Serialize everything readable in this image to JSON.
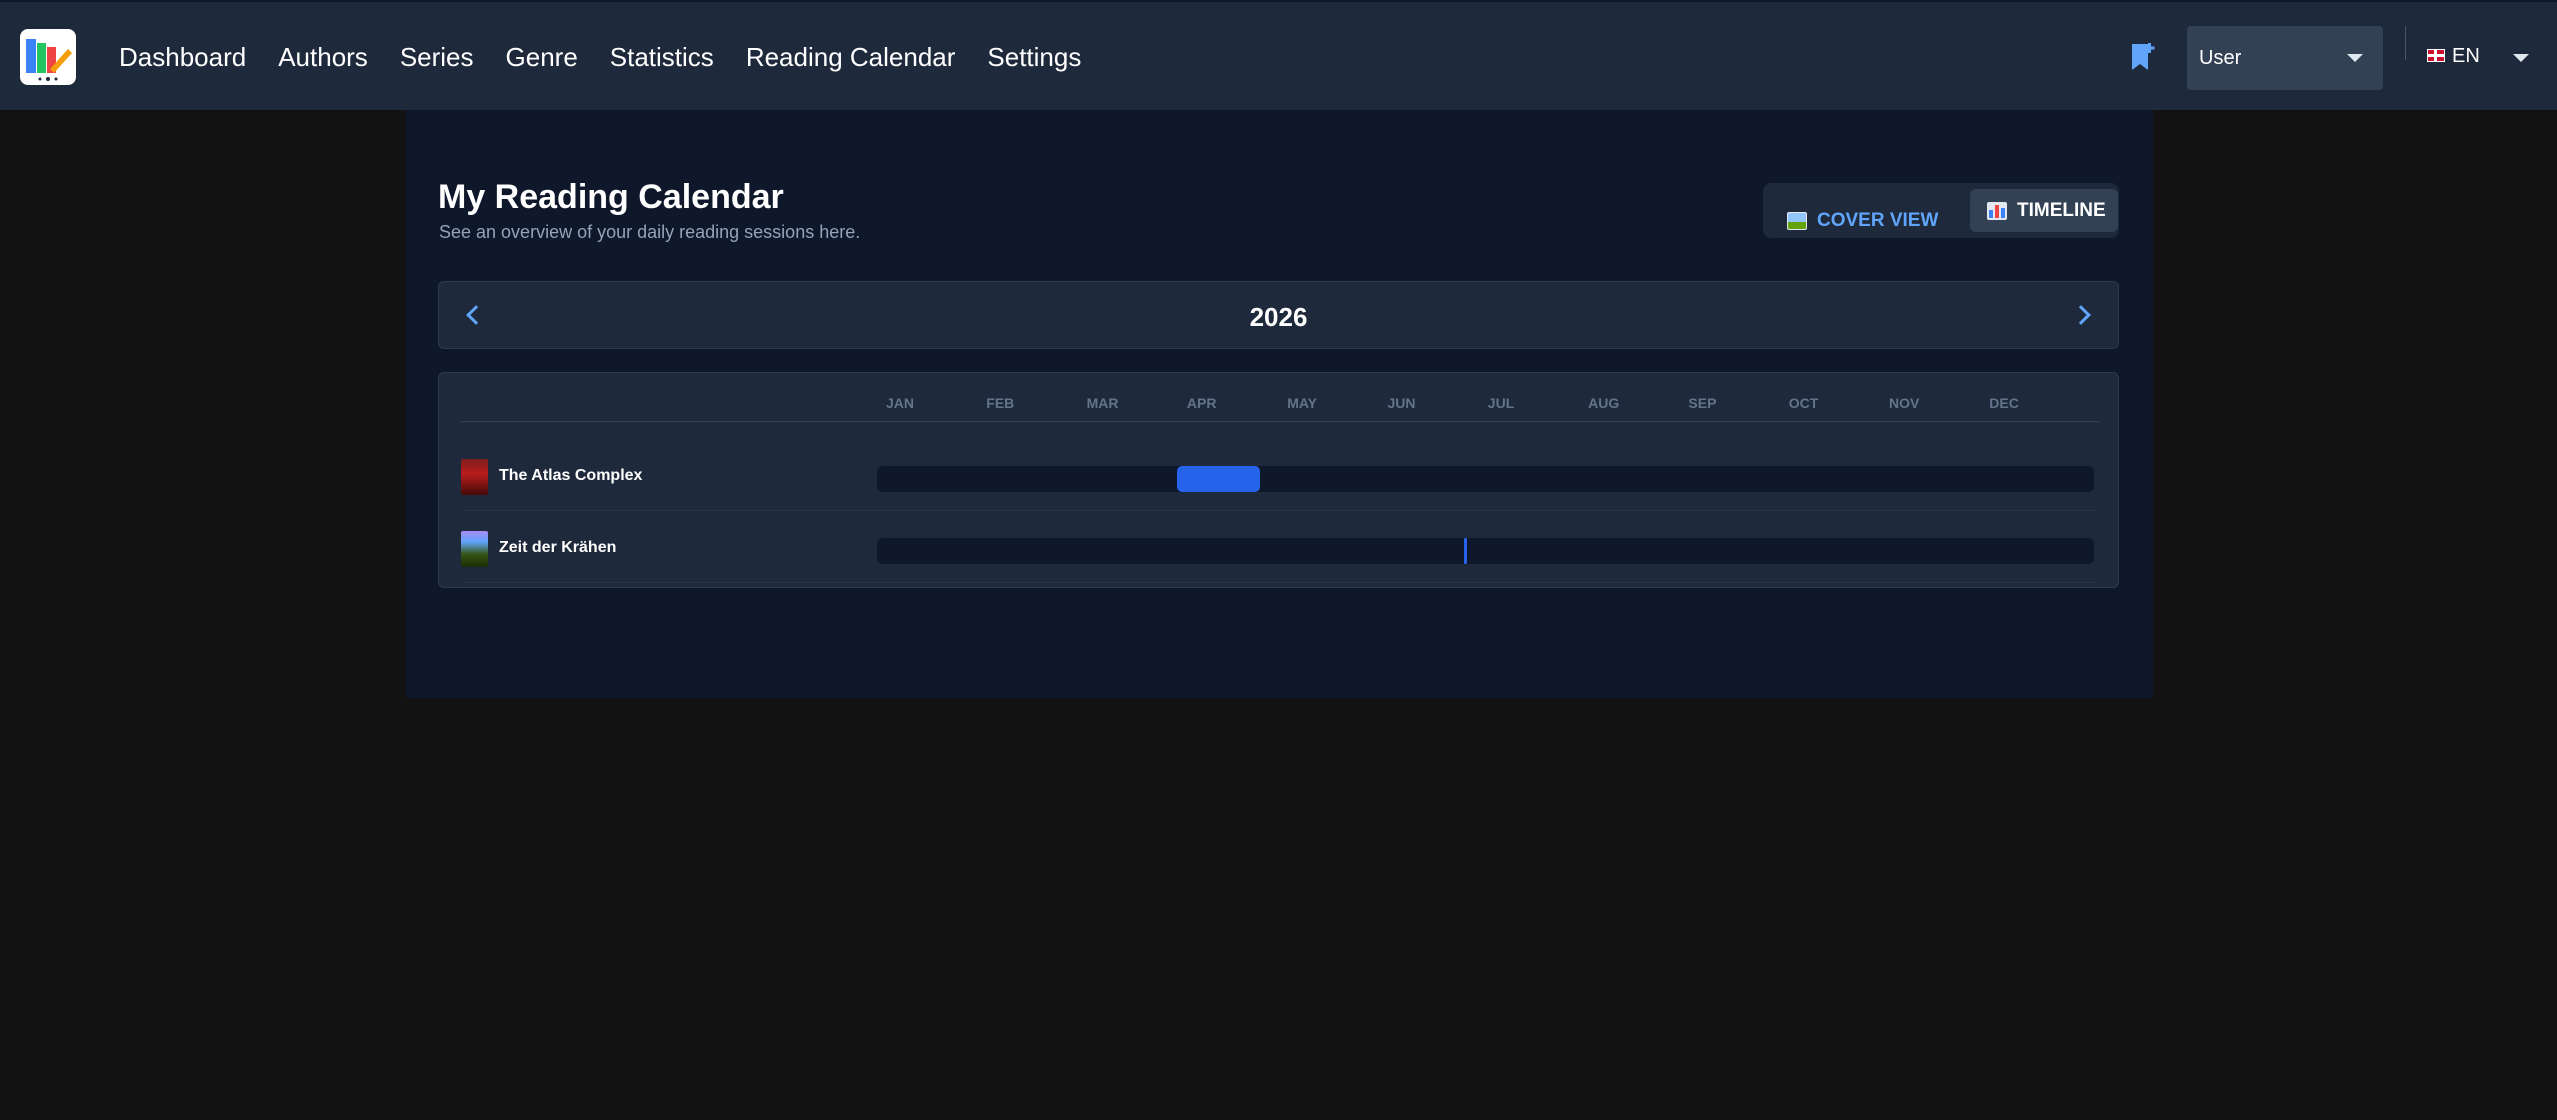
{
  "nav": {
    "items": [
      "Dashboard",
      "Authors",
      "Series",
      "Genre",
      "Statistics",
      "Reading Calendar",
      "Settings"
    ]
  },
  "header": {
    "user_select": "User",
    "language": "EN"
  },
  "page": {
    "title": "My Reading Calendar",
    "subtitle": "See an overview of your daily reading sessions here.",
    "view_toggle": {
      "cover_label": "COVER VIEW",
      "timeline_label": "TIMELINE",
      "active": "TIMELINE"
    },
    "year": "2026",
    "months": [
      "JAN",
      "FEB",
      "MAR",
      "APR",
      "MAY",
      "JUN",
      "JUL",
      "AUG",
      "SEP",
      "OCT",
      "NOV",
      "DEC"
    ],
    "books": [
      {
        "title": "The Atlas Complex",
        "reading_start": "2026-04-01",
        "reading_end": "2026-04-26"
      },
      {
        "title": "Zeit der Krähen",
        "reading_start": "2026-06-26",
        "reading_end": "2026-06-26"
      }
    ]
  },
  "colors": {
    "accent": "#60a5fa",
    "bar": "#2563eb",
    "topbar": "#1e293b",
    "panel": "#0f172a",
    "background": "#121212"
  },
  "icons": {
    "bookmark": "bookmark-plus-icon",
    "prev": "chevron-left-icon",
    "next": "chevron-right-icon",
    "cover_view": "picture-icon",
    "timeline": "bar-chart-icon"
  }
}
